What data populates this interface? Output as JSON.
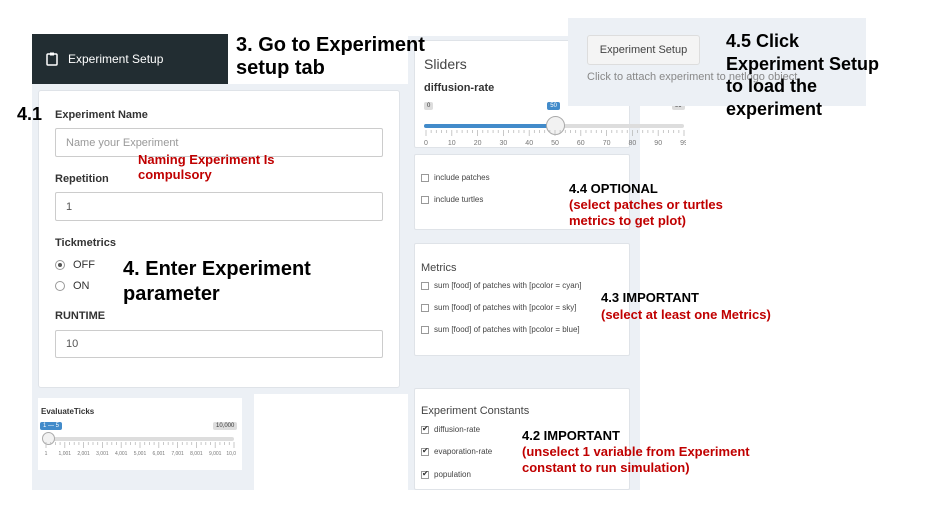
{
  "sidebar": {
    "tab_label": "Experiment Setup"
  },
  "form": {
    "experiment_name": {
      "label": "Experiment Name",
      "placeholder": "Name your Experiment"
    },
    "repetition": {
      "label": "Repetition",
      "value": "1"
    },
    "tickmetrics": {
      "label": "Tickmetrics",
      "options": [
        "OFF",
        "ON"
      ],
      "selected": "OFF"
    },
    "runtime": {
      "label": "RUNTIME",
      "value": "10"
    }
  },
  "evaluate_ticks": {
    "label": "EvaluateTicks",
    "value_badge": "1 — 5",
    "max_badge": "10,000",
    "tick_labels": [
      "1",
      "1,001",
      "2,001",
      "3,001",
      "4,001",
      "5,001",
      "6,001",
      "7,001",
      "8,001",
      "9,001",
      "10,000"
    ]
  },
  "sliders": {
    "title": "Sliders",
    "diffusion_rate": {
      "label": "diffusion-rate",
      "min": "0",
      "max": "99",
      "value": "50",
      "value_fraction": 0.505,
      "tick_labels": [
        "0",
        "10",
        "20",
        "30",
        "40",
        "50",
        "60",
        "70",
        "80",
        "90",
        "99"
      ]
    }
  },
  "include": {
    "patches": "include patches",
    "turtles": "include turtles"
  },
  "metrics": {
    "title": "Metrics",
    "items": [
      "sum [food] of patches with [pcolor = cyan]",
      "sum [food] of patches with [pcolor = sky]",
      "sum [food] of patches with [pcolor = blue]"
    ]
  },
  "constants": {
    "title": "Experiment Constants",
    "items": [
      "diffusion-rate",
      "evaporation-rate",
      "population"
    ]
  },
  "setup": {
    "button_label": "Experiment Setup",
    "hint": "Click to attach experiment to netlogo object."
  },
  "annotations": {
    "a3": [
      "3. Go to Experiment",
      "setup tab"
    ],
    "a45": [
      "4.5 Click",
      "Experiment Setup",
      "to load the",
      "experiment"
    ],
    "a41": "4.1",
    "naming": [
      "Naming Experiment Is",
      "compulsory"
    ],
    "a4": [
      "4. Enter Experiment",
      "parameter"
    ],
    "a44": [
      "4.4 OPTIONAL",
      "(select patches or turtles",
      "metrics to get plot)"
    ],
    "a43": [
      "4.3 IMPORTANT",
      "(select at least one Metrics)"
    ],
    "a42": [
      "4.2 IMPORTANT",
      "(unselect 1 variable from Experiment",
      "constant to run simulation)"
    ]
  },
  "colors": {
    "sidebar_bg": "#222d32",
    "annotation_red": "#c00000",
    "slider_accent": "#428bca"
  }
}
